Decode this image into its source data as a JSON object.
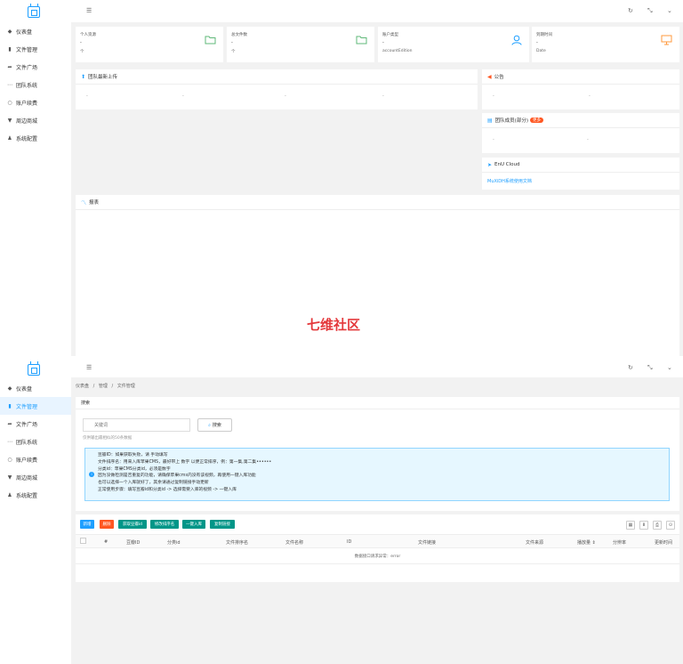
{
  "menu": [
    {
      "icon": "dashboard-icon",
      "glyph": "◆",
      "label": "仪表盘"
    },
    {
      "icon": "file-icon",
      "glyph": "▮",
      "label": "文件管理"
    },
    {
      "icon": "share-icon",
      "glyph": "➦",
      "label": "文件广场"
    },
    {
      "icon": "ellipsis-icon",
      "glyph": "⋯",
      "label": "团队系统"
    },
    {
      "icon": "circle-icon",
      "glyph": "○",
      "label": "账户续费"
    },
    {
      "icon": "cart-icon",
      "glyph": "▼",
      "label": "周边商城"
    },
    {
      "icon": "user-icon",
      "glyph": "♟",
      "label": "系统配置"
    }
  ],
  "header": {
    "menu_glyph": "☰",
    "refresh_glyph": "↻",
    "fullscreen_glyph": "⤡",
    "more_glyph": "⌄"
  },
  "stats": [
    {
      "title": "个人资源",
      "value": "-",
      "sub": "个",
      "icon": "folder-icon",
      "color": "#5fb878"
    },
    {
      "title": "总文件数",
      "value": "-",
      "sub": "个",
      "icon": "folder-icon",
      "color": "#5fb878"
    },
    {
      "title": "账户类型",
      "value": "-",
      "sub": "accountEdition",
      "icon": "user-outline-icon",
      "color": "#1e9fff"
    },
    {
      "title": "到期时间",
      "value": "-",
      "sub": "Date",
      "icon": "presentation-icon",
      "color": "#ff9a3c"
    }
  ],
  "recent_uploads": {
    "icon": "rocket-icon",
    "glyph": "⬆",
    "title": "团队最新上传",
    "placeholders": [
      "-",
      "-",
      "-",
      "-"
    ]
  },
  "notice": {
    "icon": "megaphone-icon",
    "glyph": "◀",
    "title": "公告",
    "placeholders": [
      "-",
      "-"
    ]
  },
  "team_members": {
    "icon": "group-icon",
    "glyph": "▤",
    "title": "团队成员(部分)",
    "badge": "更多",
    "placeholders": [
      "-",
      "-"
    ]
  },
  "cloud": {
    "icon": "paper-plane-icon",
    "glyph": "➤",
    "title": "EnU Cloud",
    "link": "MuXiDH系统使用文档"
  },
  "report": {
    "icon": "chart-icon",
    "glyph": "〽",
    "title": "报表"
  },
  "watermark": "七维社区",
  "breadcrumb": [
    "仪表盘",
    "管理",
    "文件管理"
  ],
  "search": {
    "section_title": "搜索",
    "placeholder": "关键词",
    "button_label": "搜索",
    "hint": "仅供输出最相似的50条数据"
  },
  "info_box": {
    "lines": [
      "豆瓣ID：如果获取失败，请 手动填写",
      "文件排序名：用来入库苹果CMS，最好带上 数字 以便正常排序，例：第一集,第二集••••••",
      "分类id：苹果CMS分类id，必须是数字",
      "因为没做检测是否重复的功能，请确保苹果cms内没有该视频，再使用一键入库功能",
      "也可以选择一个入库就好了，其余请通过复制链接手动更新",
      "正常使用步骤：填写豆瓣id和分类id -> 选择需要入库的视频 -> 一键入库"
    ]
  },
  "toolbar_buttons": [
    {
      "label": "新增",
      "color": "#1e9fff"
    },
    {
      "label": "删除",
      "color": "#ff5722"
    },
    {
      "label": "获取豆瓣id",
      "color": "#009688"
    },
    {
      "label": "修改排序名",
      "color": "#009688"
    },
    {
      "label": "一键入库",
      "color": "#009688"
    },
    {
      "label": "复制链接",
      "color": "#009688"
    }
  ],
  "table_tools": [
    "▦",
    "⬇",
    "⎙",
    "⊙"
  ],
  "table_headers": [
    "#",
    "豆瓣ID",
    "分类id",
    "文件排序名",
    "文件名称",
    "ID",
    "文件链接",
    "文件来源",
    "播放量 ⇕",
    "分辨率",
    "更新时间"
  ],
  "table_error": "数据接口请求异常：error"
}
